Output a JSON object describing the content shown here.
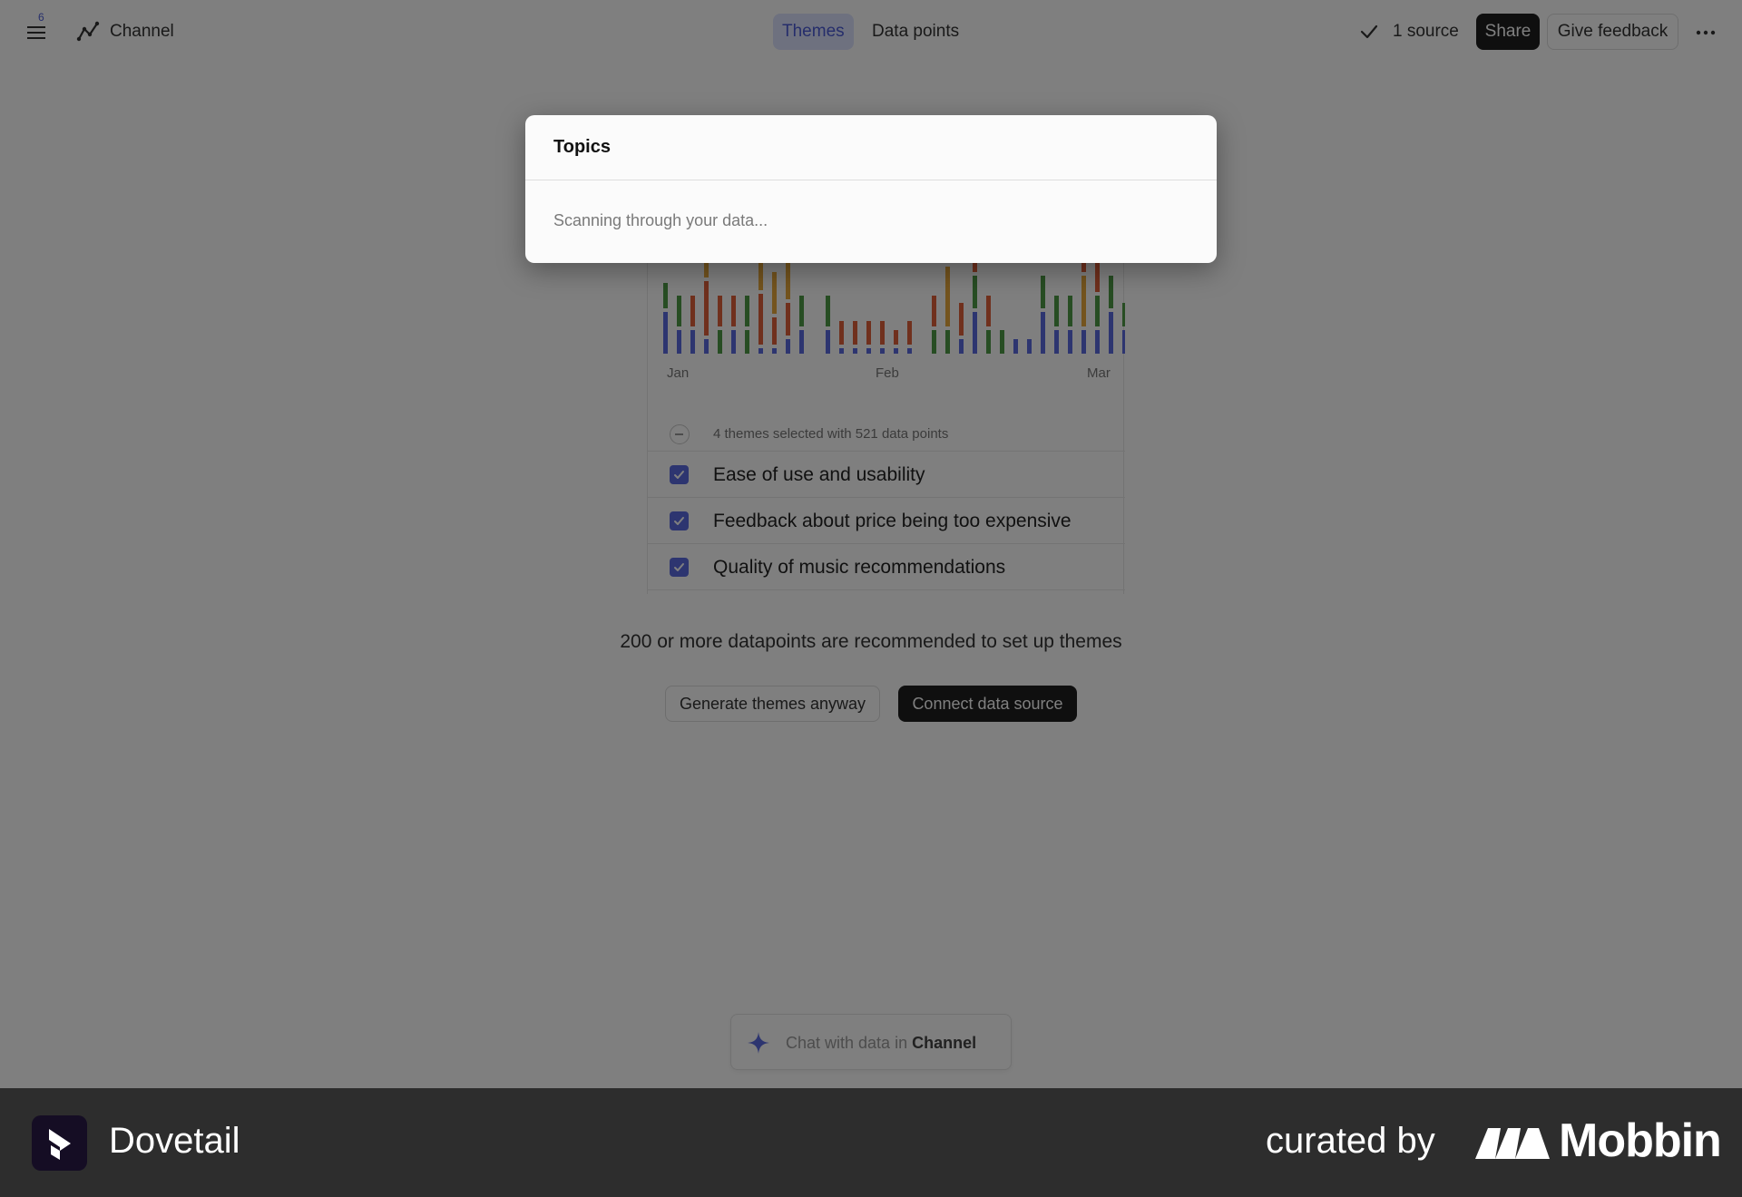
{
  "header": {
    "menu_badge": "6",
    "channel_title": "Channel",
    "tabs": [
      {
        "label": "Themes",
        "active": true
      },
      {
        "label": "Data points",
        "active": false
      }
    ],
    "source_label": "1 source",
    "share_label": "Share",
    "feedback_label": "Give feedback"
  },
  "chart_data": {
    "type": "bar",
    "stacked": true,
    "x_tick_labels": [
      "Jan",
      "Feb",
      "Mar"
    ],
    "series_colors": [
      "#5b6be0",
      "#4e9a46",
      "#e0603a",
      "#e9a93c"
    ],
    "note_grid": false
  },
  "selection": {
    "summary": "4 themes selected with 521 data points"
  },
  "themes": [
    {
      "label": "Ease of use and usability",
      "checked": true
    },
    {
      "label": "Feedback about price being too expensive",
      "checked": true
    },
    {
      "label": "Quality of music recommendations",
      "checked": true
    }
  ],
  "recommendation_text": "200 or more datapoints are recommended to set up themes",
  "actions": {
    "generate_label": "Generate themes anyway",
    "connect_label": "Connect data source"
  },
  "chat": {
    "prefix": "Chat with data in",
    "channel": "Channel"
  },
  "modal": {
    "title": "Topics",
    "body": "Scanning through your data..."
  },
  "footer": {
    "app_name": "Dovetail",
    "curated_by": "curated by",
    "brand": "Mobbin"
  },
  "colors": {
    "accent": "#5b6be0",
    "dark_button": "#1e1e1e",
    "footer_bg": "#2d2d2d"
  }
}
